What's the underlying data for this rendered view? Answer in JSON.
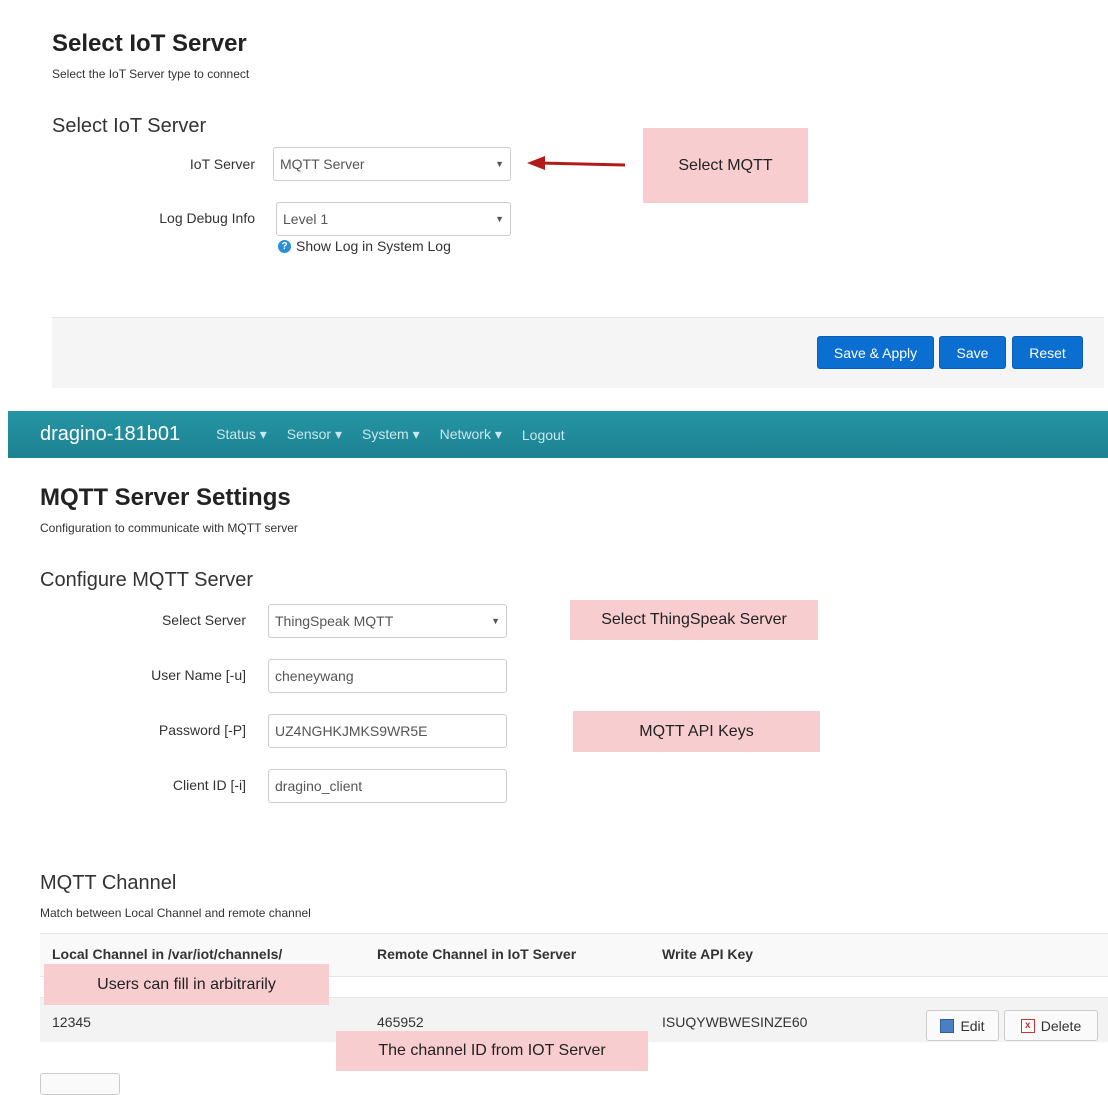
{
  "iot_section": {
    "title": "Select IoT Server",
    "description": "Select the IoT Server type to connect",
    "subtitle": "Select IoT Server",
    "server_label": "IoT Server",
    "server_value": "MQTT Server",
    "log_label": "Log Debug Info",
    "log_value": "Level 1",
    "help_text": "Show Log in System Log",
    "note_select_mqtt": "Select MQTT"
  },
  "action_bar": {
    "save_apply": "Save & Apply",
    "save": "Save",
    "reset": "Reset"
  },
  "navbar": {
    "brand": "dragino-181b01",
    "items": [
      "Status ▾",
      "Sensor ▾",
      "System ▾",
      "Network ▾",
      "Logout"
    ]
  },
  "mqtt_section": {
    "title": "MQTT Server Settings",
    "description": "Configuration to communicate with MQTT server",
    "subtitle": "Configure MQTT Server",
    "select_server_label": "Select Server",
    "select_server_value": "ThingSpeak MQTT",
    "username_label": "User Name [-u]",
    "username_value": "cheneywang",
    "password_label": "Password [-P]",
    "password_value": "UZ4NGHKJMKS9WR5E",
    "clientid_label": "Client ID [-i]",
    "clientid_value": "dragino_client",
    "note_thingspeak": "Select ThingSpeak Server",
    "note_api_keys": "MQTT API Keys"
  },
  "channel_section": {
    "title": "MQTT Channel",
    "description": "Match between Local Channel and remote channel",
    "columns": [
      "Local Channel in /var/iot/channels/",
      "Remote Channel in IoT Server",
      "Write API Key"
    ],
    "rows": [
      {
        "local": "12345",
        "remote": "465952",
        "key": "ISUQYWBWESINZE60"
      }
    ],
    "edit_label": "Edit",
    "delete_label": "Delete",
    "note_users": "Users can fill in arbitrarily",
    "note_channel_id": "The channel ID from IOT Server"
  },
  "colors": {
    "primary_button": "#0a6fd0",
    "navbar": "#1d8292",
    "note": "#f8cdd0"
  }
}
